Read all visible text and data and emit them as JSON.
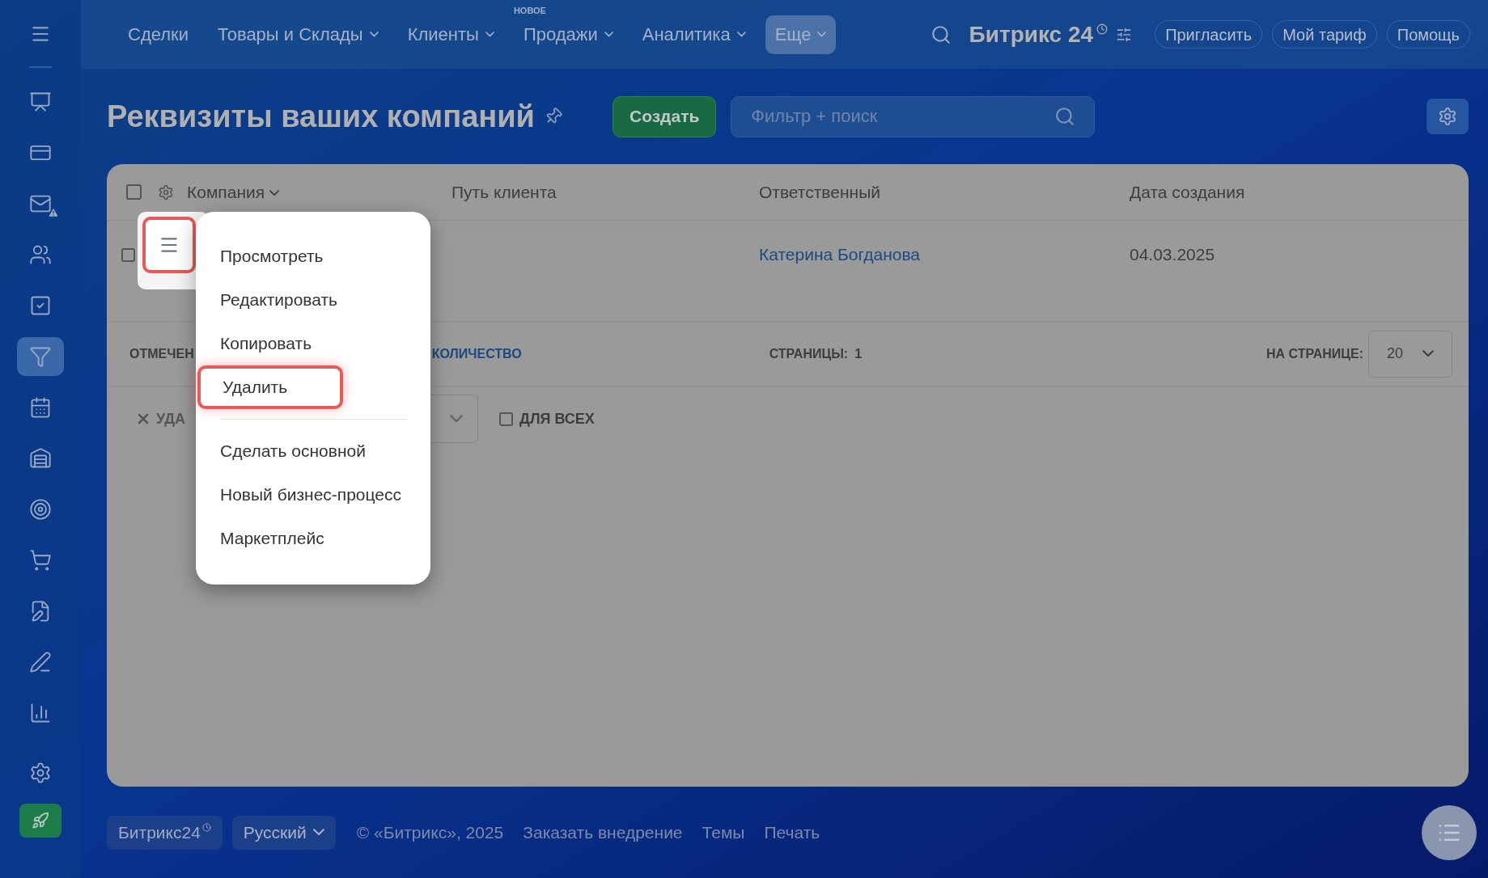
{
  "top_nav": {
    "items": [
      {
        "label": "Сделки",
        "dropdown": false,
        "selected": false
      },
      {
        "label": "Товары и Склады",
        "dropdown": true,
        "selected": false
      },
      {
        "label": "Клиенты",
        "dropdown": true,
        "selected": false
      },
      {
        "label": "Продажи",
        "dropdown": true,
        "selected": false,
        "badge": "НОВОЕ"
      },
      {
        "label": "Аналитика",
        "dropdown": true,
        "selected": false
      },
      {
        "label": "Еще",
        "dropdown": true,
        "selected": true
      }
    ],
    "logo": "Битрикс 24",
    "buttons": [
      "Пригласить",
      "Мой тариф",
      "Помощь"
    ]
  },
  "sidebar": {
    "items": [
      {
        "selected": false,
        "alert": false
      },
      {
        "selected": false,
        "alert": false
      },
      {
        "selected": false,
        "alert": true
      },
      {
        "selected": false,
        "alert": false
      },
      {
        "selected": false,
        "alert": false
      },
      {
        "selected": true,
        "alert": false
      },
      {
        "selected": false,
        "alert": false
      },
      {
        "selected": false,
        "alert": false
      },
      {
        "selected": false,
        "alert": false
      },
      {
        "selected": false,
        "alert": false
      },
      {
        "selected": false,
        "alert": false
      },
      {
        "selected": false,
        "alert": false
      },
      {
        "selected": false,
        "alert": false
      }
    ]
  },
  "page": {
    "title": "Реквизиты ваших компаний",
    "create_button": "Создать",
    "search": {
      "placeholder": "Фильтр + поиск"
    }
  },
  "table": {
    "all_checked": false,
    "columns": [
      "Компания",
      "Путь клиента",
      "Ответственный",
      "Дата создания"
    ],
    "rows": [
      {
        "checked": false,
        "responsible": "Катерина Богданова",
        "created": "04.03.2025"
      }
    ],
    "footer": {
      "selected_label": "ОТМЕЧЕН",
      "count_link": "КОЛИЧЕСТВО",
      "pages_label": "СТРАНИЦЫ:",
      "pages_value": "1",
      "per_page_label": "НА СТРАНИЦЕ:",
      "per_page_value": "20"
    },
    "actions": {
      "delete_label": "УДА",
      "for_all_label": "ДЛЯ ВСЕХ",
      "for_all_checked": false
    }
  },
  "context_menu": {
    "items": [
      {
        "kind": "item",
        "label": "Просмотреть",
        "highlighted": false
      },
      {
        "kind": "item",
        "label": "Редактировать",
        "highlighted": false
      },
      {
        "kind": "item",
        "label": "Копировать",
        "highlighted": false
      },
      {
        "kind": "item",
        "label": "Удалить",
        "highlighted": true
      },
      {
        "kind": "divider"
      },
      {
        "kind": "item",
        "label": "Сделать основной",
        "highlighted": false
      },
      {
        "kind": "item",
        "label": "Новый бизнес-процесс",
        "highlighted": false
      },
      {
        "kind": "item",
        "label": "Маркетплейс",
        "highlighted": false
      }
    ]
  },
  "footer": {
    "brand": "Битрикс24",
    "language": "Русский",
    "copyright": "© «Битрикс», 2025",
    "links": [
      "Заказать внедрение",
      "Темы",
      "Печать"
    ]
  }
}
